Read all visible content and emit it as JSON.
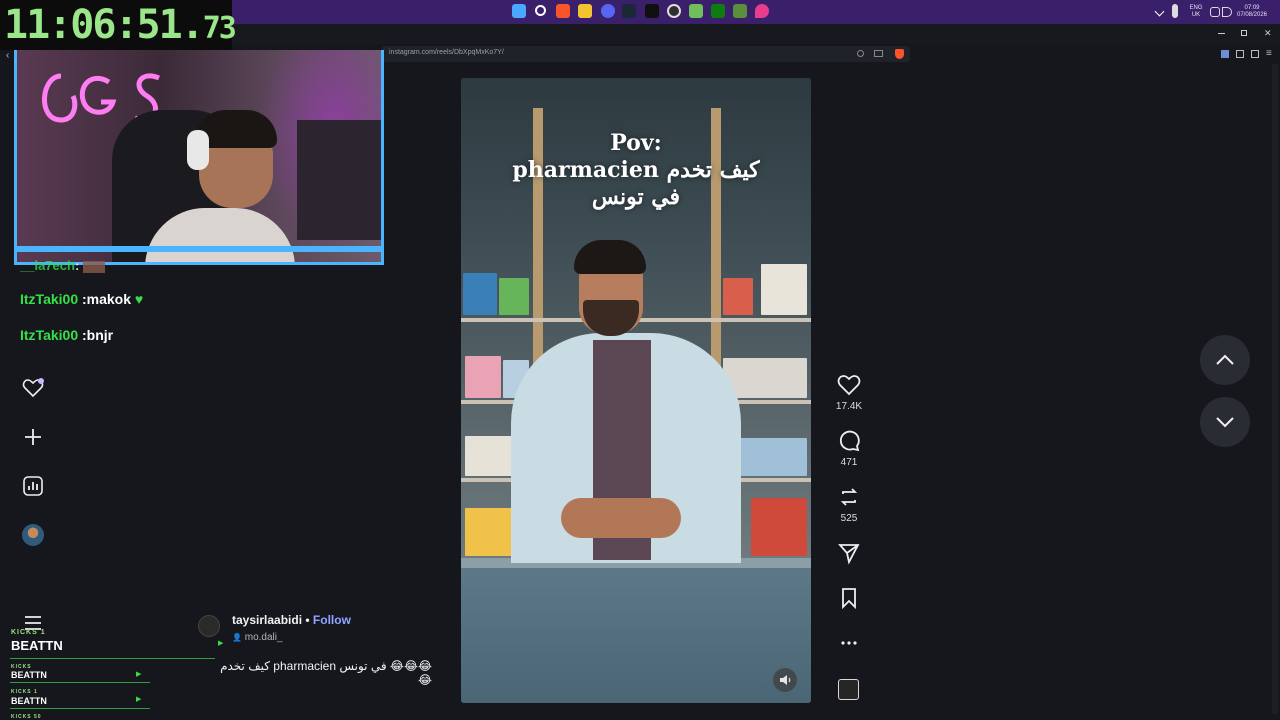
{
  "timer": {
    "main": "11:06:51.",
    "ms": "73"
  },
  "tray": {
    "lang": "ENG",
    "region": "UK",
    "time": "07:09",
    "date": "07/08/2026"
  },
  "browser": {
    "url": "instagram.com/reels/DbXpqMxKo7Y/"
  },
  "chat": [
    {
      "user": "__la7ech",
      "msg": ":"
    },
    {
      "user": "ItzTaki00",
      "msg": " :makok"
    },
    {
      "user": "ItzTaki00",
      "msg": " :bnjr"
    }
  ],
  "kicks": {
    "label": "KICKS 1",
    "name": "BEATTN",
    "rows": [
      {
        "label": "KICKS",
        "name": "BEATTN"
      },
      {
        "label": "KICKS 1",
        "name": "BEATTN"
      },
      {
        "label": "KICKS 50",
        "name": ""
      }
    ]
  },
  "reel": {
    "overlay_line1": "Pov:",
    "overlay_line2": "pharmacien كيف تخدم",
    "overlay_line3": "في تونس",
    "author": "taysirlaabidi",
    "separator": " • ",
    "follow": "Follow",
    "audio": "mo.dali_",
    "caption": "كيف تخدم pharmacien في تونس 😂😂😂 😂"
  },
  "actions": {
    "likes": "17.4K",
    "comments": "471",
    "reposts": "525"
  },
  "colors": {
    "taskbar": "#3a1f6b",
    "timer": "#9be68a",
    "chat_user": "#35e046",
    "webcam_border": "#4ab4ff",
    "follow": "#8ea6ff"
  }
}
